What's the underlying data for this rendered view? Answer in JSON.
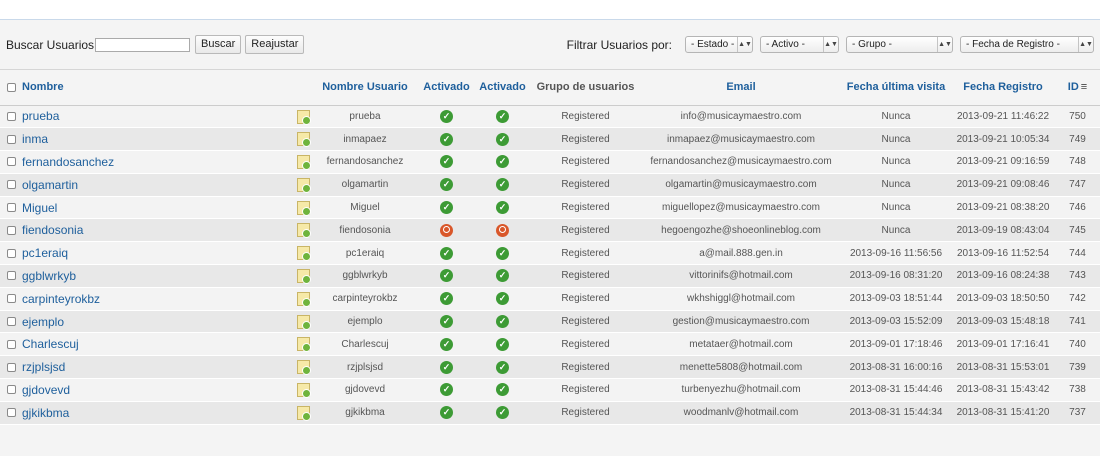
{
  "toolbar": {
    "search_label": "Buscar Usuarios",
    "search_value": "",
    "search_button": "Buscar",
    "reset_button": "Reajustar",
    "filter_label": "Filtrar Usuarios por:",
    "filters": [
      {
        "label": "- Estado -"
      },
      {
        "label": "- Activo -"
      },
      {
        "label": "- Grupo -"
      },
      {
        "label": "- Fecha de Registro -"
      }
    ]
  },
  "table": {
    "headers": {
      "name": "Nombre",
      "username": "Nombre Usuario",
      "activated1": "Activado",
      "activated2": "Activado",
      "group": "Grupo de usuarios",
      "email": "Email",
      "last_visit": "Fecha última visita",
      "registered": "Fecha Registro",
      "id": "ID"
    },
    "rows": [
      {
        "name": "prueba",
        "username": "prueba",
        "a1": "ok",
        "a2": "ok",
        "group": "Registered",
        "email": "info@musicaymaestro.com",
        "last_visit": "Nunca",
        "registered": "2013-09-21 11:46:22",
        "id": "750"
      },
      {
        "name": "inma",
        "username": "inmapaez",
        "a1": "ok",
        "a2": "ok",
        "group": "Registered",
        "email": "inmapaez@musicaymaestro.com",
        "last_visit": "Nunca",
        "registered": "2013-09-21 10:05:34",
        "id": "749"
      },
      {
        "name": "fernandosanchez",
        "username": "fernandosanchez",
        "a1": "ok",
        "a2": "ok",
        "group": "Registered",
        "email": "fernandosanchez@musicaymaestro.com",
        "last_visit": "Nunca",
        "registered": "2013-09-21 09:16:59",
        "id": "748"
      },
      {
        "name": "olgamartin",
        "username": "olgamartin",
        "a1": "ok",
        "a2": "ok",
        "group": "Registered",
        "email": "olgamartin@musicaymaestro.com",
        "last_visit": "Nunca",
        "registered": "2013-09-21 09:08:46",
        "id": "747"
      },
      {
        "name": "Miguel",
        "username": "Miguel",
        "a1": "ok",
        "a2": "ok",
        "group": "Registered",
        "email": "miguellopez@musicaymaestro.com",
        "last_visit": "Nunca",
        "registered": "2013-09-21 08:38:20",
        "id": "746"
      },
      {
        "name": "fiendosonia",
        "username": "fiendosonia",
        "a1": "no",
        "a2": "no",
        "group": "Registered",
        "email": "hegoengozhe@shoeonlineblog.com",
        "last_visit": "Nunca",
        "registered": "2013-09-19 08:43:04",
        "id": "745"
      },
      {
        "name": "pc1eraiq",
        "username": "pc1eraiq",
        "a1": "ok",
        "a2": "ok",
        "group": "Registered",
        "email": "a@mail.888.gen.in",
        "last_visit": "2013-09-16 11:56:56",
        "registered": "2013-09-16 11:52:54",
        "id": "744"
      },
      {
        "name": "ggblwrkyb",
        "username": "ggblwrkyb",
        "a1": "ok",
        "a2": "ok",
        "group": "Registered",
        "email": "vittorinifs@hotmail.com",
        "last_visit": "2013-09-16 08:31:20",
        "registered": "2013-09-16 08:24:38",
        "id": "743"
      },
      {
        "name": "carpinteyrokbz",
        "username": "carpinteyrokbz",
        "a1": "ok",
        "a2": "ok",
        "group": "Registered",
        "email": "wkhshiggl@hotmail.com",
        "last_visit": "2013-09-03 18:51:44",
        "registered": "2013-09-03 18:50:50",
        "id": "742"
      },
      {
        "name": "ejemplo",
        "username": "ejemplo",
        "a1": "ok",
        "a2": "ok",
        "group": "Registered",
        "email": "gestion@musicaymaestro.com",
        "last_visit": "2013-09-03 15:52:09",
        "registered": "2013-09-03 15:48:18",
        "id": "741"
      },
      {
        "name": "Charlescuj",
        "username": "Charlescuj",
        "a1": "ok",
        "a2": "ok",
        "group": "Registered",
        "email": "metataer@hotmail.com",
        "last_visit": "2013-09-01 17:18:46",
        "registered": "2013-09-01 17:16:41",
        "id": "740"
      },
      {
        "name": "rzjplsjsd",
        "username": "rzjplsjsd",
        "a1": "ok",
        "a2": "ok",
        "group": "Registered",
        "email": "menette5808@hotmail.com",
        "last_visit": "2013-08-31 16:00:16",
        "registered": "2013-08-31 15:53:01",
        "id": "739"
      },
      {
        "name": "gjdovevd",
        "username": "gjdovevd",
        "a1": "ok",
        "a2": "ok",
        "group": "Registered",
        "email": "turbenyezhu@hotmail.com",
        "last_visit": "2013-08-31 15:44:46",
        "registered": "2013-08-31 15:43:42",
        "id": "738"
      },
      {
        "name": "gjkikbma",
        "username": "gjkikbma",
        "a1": "ok",
        "a2": "ok",
        "group": "Registered",
        "email": "woodmanlv@hotmail.com",
        "last_visit": "2013-08-31 15:44:34",
        "registered": "2013-08-31 15:41:20",
        "id": "737"
      }
    ]
  }
}
